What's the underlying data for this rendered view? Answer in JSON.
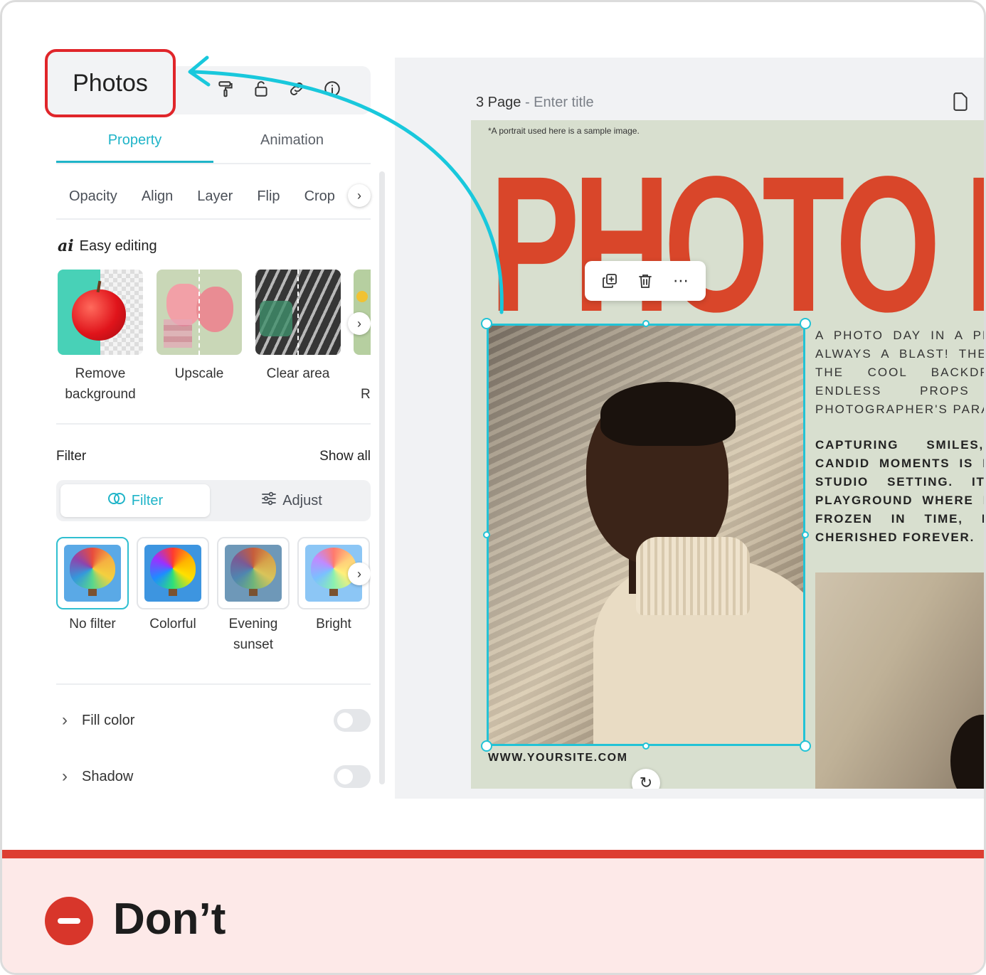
{
  "panel": {
    "title": "Photos",
    "tabs": [
      {
        "label": "Property",
        "active": true
      },
      {
        "label": "Animation",
        "active": false
      }
    ],
    "tools": [
      "Opacity",
      "Align",
      "Layer",
      "Flip",
      "Crop"
    ],
    "easy_editing": {
      "title": "Easy editing",
      "ai_mark": "ai",
      "items": [
        {
          "label": "Remove\nbackground"
        },
        {
          "label": "Upscale"
        },
        {
          "label": "Clear area"
        },
        {
          "label": "Re"
        }
      ]
    },
    "filter": {
      "title": "Filter",
      "show_all": "Show all",
      "seg_filter": "Filter",
      "seg_adjust": "Adjust",
      "items": [
        {
          "label": "No filter",
          "selected": true
        },
        {
          "label": "Colorful",
          "selected": false
        },
        {
          "label": "Evening\nsunset",
          "selected": false
        },
        {
          "label": "Bright",
          "selected": false
        }
      ]
    },
    "fill_color": "Fill color",
    "shadow": "Shadow"
  },
  "canvas": {
    "page_label": "3 Page",
    "page_sep": " - ",
    "page_placeholder": "Enter title",
    "note": "*A portrait used here is a sample image.",
    "big_title": "PHOTO DA",
    "url": "WWW.YOURSITE.COM",
    "para1": "A  PHOTO  DAY  IN  A  PHO\nALWAYS  A  BLAST!  THE  V\nTHE     COOL     BACKDROP\nENDLESS        PROPS       MA\nPHOTOGRAPHER'S PARADIS",
    "para2": "CAPTURING      SMILES,\nCANDID  MOMENTS  IS  PU\nSTUDIO    SETTING.    IT'S\nPLAYGROUND  WHERE  M\nFROZEN    IN    TIME,    RE\nCHERISHED FOREVER."
  },
  "footer": {
    "label": "Don’t"
  },
  "colors": {
    "accent": "#1fb4c8",
    "highlight": "#e0252a",
    "arrow": "#19c8dc",
    "title_orange": "#d9462a",
    "dont_red": "#d8362b"
  }
}
